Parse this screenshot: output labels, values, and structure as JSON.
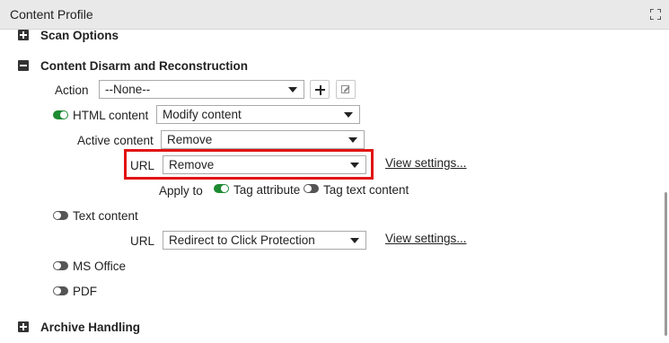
{
  "window": {
    "title": "Content Profile",
    "expand_icon": "expand-icon"
  },
  "sections": {
    "scan_options": {
      "label": "Scan Options",
      "state": "collapsed"
    },
    "cdr": {
      "label": "Content Disarm and Reconstruction",
      "state": "expanded"
    },
    "archive_handling": {
      "label": "Archive Handling",
      "state": "collapsed"
    }
  },
  "cdr": {
    "action": {
      "label": "Action",
      "value": "--None--"
    },
    "html_content": {
      "label": "HTML content",
      "enabled": true,
      "value": "Modify content",
      "active_content": {
        "label": "Active content",
        "value": "Remove"
      },
      "url": {
        "label": "URL",
        "value": "Remove",
        "view_settings": "View settings..."
      },
      "apply_to": {
        "label": "Apply to",
        "tag_attribute": {
          "label": "Tag attribute",
          "enabled": true
        },
        "tag_text_content": {
          "label": "Tag text content",
          "enabled": false
        }
      }
    },
    "text_content": {
      "label": "Text content",
      "enabled": false,
      "url": {
        "label": "URL",
        "value": "Redirect to Click Protection",
        "view_settings": "View settings..."
      }
    },
    "ms_office": {
      "label": "MS Office",
      "enabled": false
    },
    "pdf": {
      "label": "PDF",
      "enabled": false
    }
  },
  "colors": {
    "toggle_on": "#1e8a32",
    "toggle_off": "#555555",
    "highlight": "#e11414",
    "titlebar": "#e9e9e9"
  }
}
